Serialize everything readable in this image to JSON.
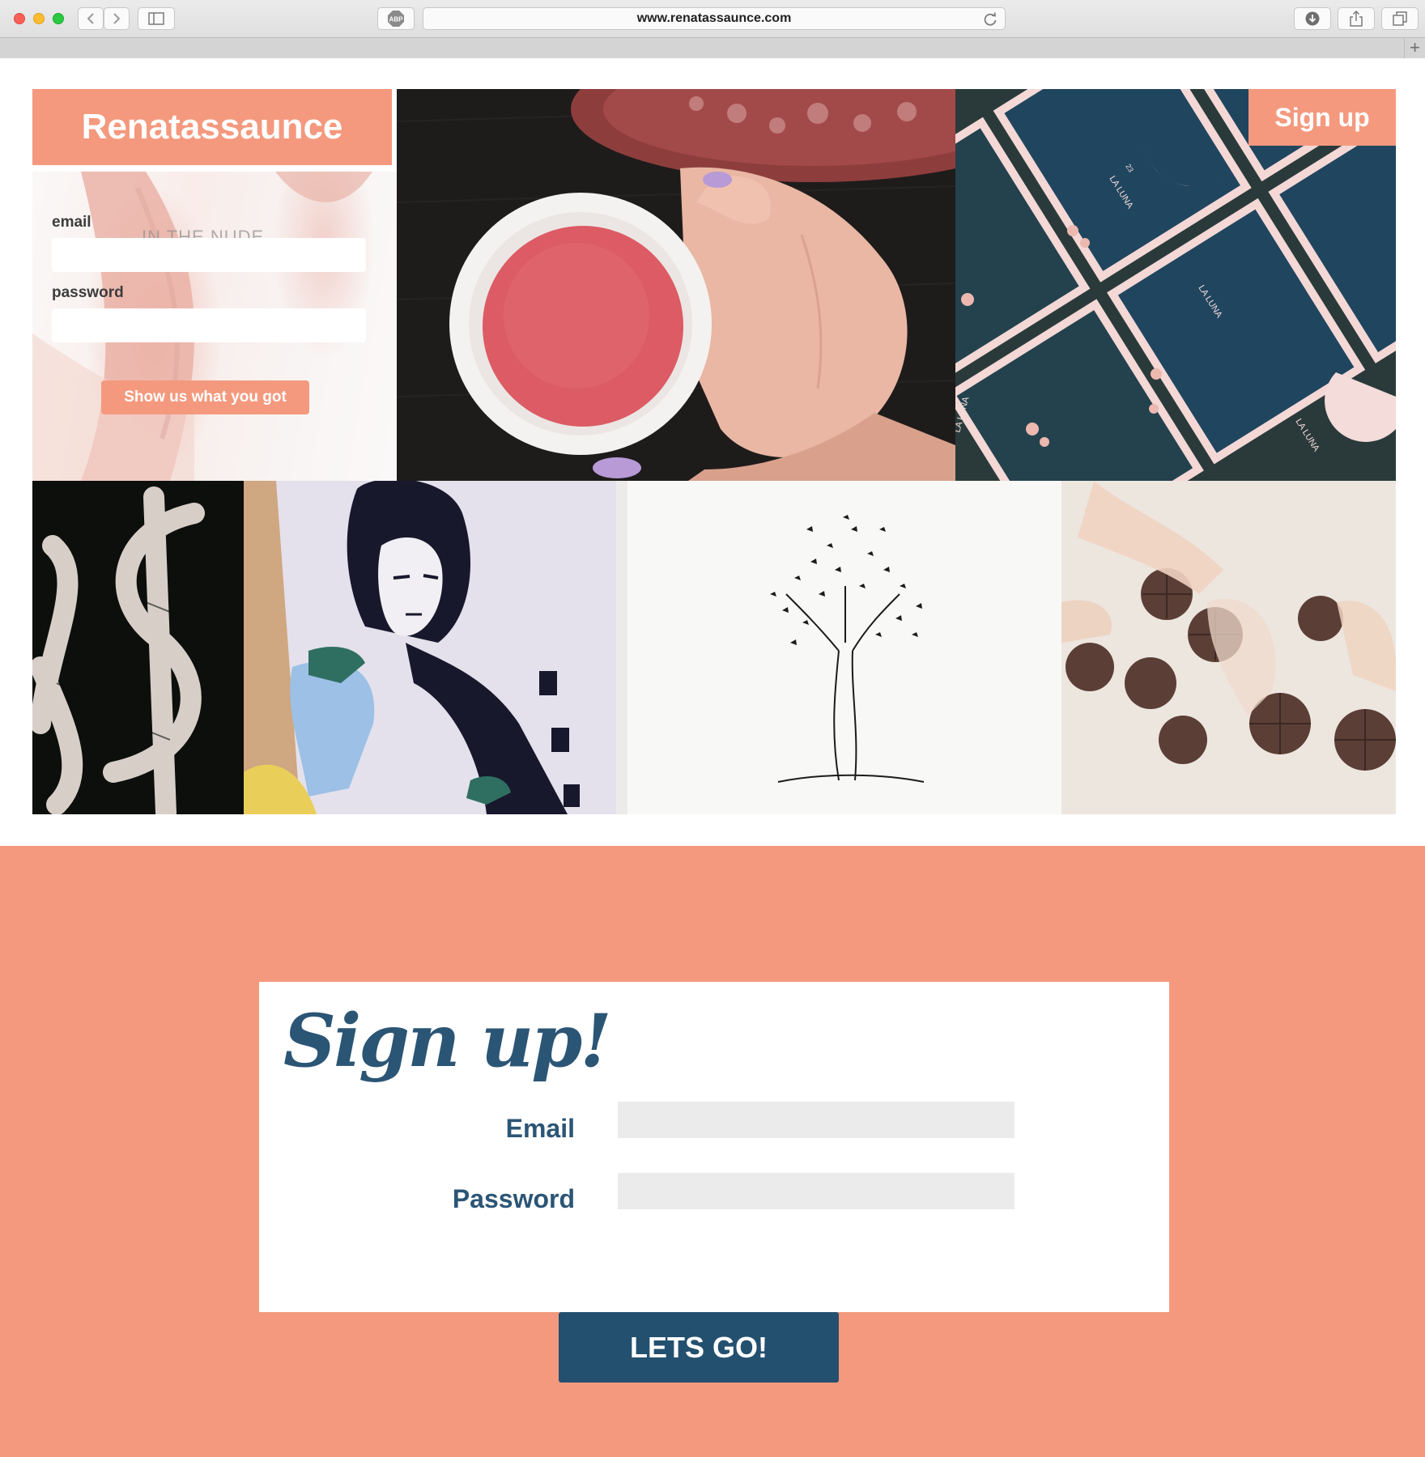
{
  "browser": {
    "url": "www.renatassaunce.com",
    "adblock_label": "ABP"
  },
  "site": {
    "brand": "Renatassaunce",
    "signup_top_label": "Sign up"
  },
  "login": {
    "email_label": "email",
    "password_label": "password",
    "submit_label": "Show us what you got",
    "photo_text": "IN THE NUDE"
  },
  "signup": {
    "title": "Sign up!",
    "email_label": "Email",
    "password_label": "Password",
    "submit_label": "LETS GO!"
  },
  "moon_card_text": "LA LUNA",
  "moon_card_number": "23",
  "colors": {
    "accent": "#f4997e",
    "navy": "#24506f",
    "title_blue": "#2b5575"
  }
}
